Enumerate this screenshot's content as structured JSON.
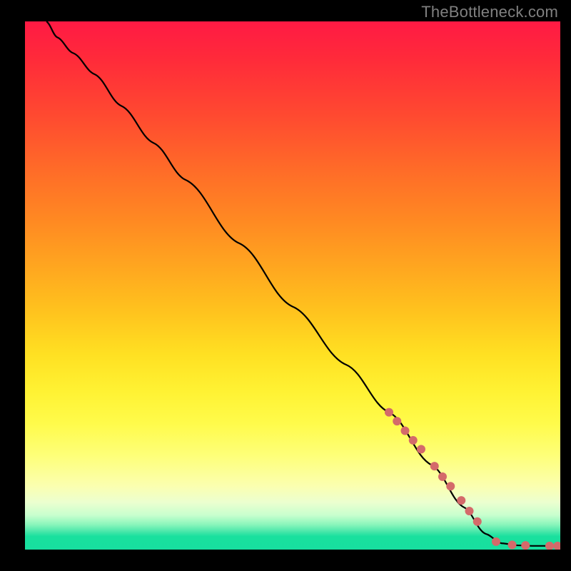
{
  "attribution": "TheBottleneck.com",
  "chart_data": {
    "type": "line",
    "title": "",
    "xlabel": "",
    "ylabel": "",
    "xlim": [
      0,
      100
    ],
    "ylim": [
      0,
      100
    ],
    "curve": [
      {
        "x": 4,
        "y": 100
      },
      {
        "x": 6,
        "y": 97
      },
      {
        "x": 9,
        "y": 94
      },
      {
        "x": 13,
        "y": 90
      },
      {
        "x": 18,
        "y": 84
      },
      {
        "x": 24,
        "y": 77
      },
      {
        "x": 30,
        "y": 70
      },
      {
        "x": 40,
        "y": 58
      },
      {
        "x": 50,
        "y": 46
      },
      {
        "x": 60,
        "y": 35
      },
      {
        "x": 68,
        "y": 26
      },
      {
        "x": 76,
        "y": 16
      },
      {
        "x": 82,
        "y": 8
      },
      {
        "x": 86,
        "y": 3
      },
      {
        "x": 89,
        "y": 1.2
      },
      {
        "x": 92,
        "y": 0.8
      },
      {
        "x": 95,
        "y": 0.7
      },
      {
        "x": 98,
        "y": 0.7
      },
      {
        "x": 100,
        "y": 0.7
      }
    ],
    "dots": [
      {
        "x": 68,
        "y": 26,
        "r": 6
      },
      {
        "x": 69.5,
        "y": 24.3,
        "r": 6
      },
      {
        "x": 71,
        "y": 22.5,
        "r": 6
      },
      {
        "x": 72.5,
        "y": 20.7,
        "r": 6
      },
      {
        "x": 74,
        "y": 19,
        "r": 6
      },
      {
        "x": 76.5,
        "y": 15.8,
        "r": 6
      },
      {
        "x": 78,
        "y": 13.8,
        "r": 6
      },
      {
        "x": 79.5,
        "y": 12,
        "r": 6
      },
      {
        "x": 81.5,
        "y": 9.3,
        "r": 6
      },
      {
        "x": 83,
        "y": 7.3,
        "r": 6
      },
      {
        "x": 84.5,
        "y": 5.3,
        "r": 6
      },
      {
        "x": 88,
        "y": 1.5,
        "r": 6
      },
      {
        "x": 91,
        "y": 0.9,
        "r": 6
      },
      {
        "x": 93.5,
        "y": 0.8,
        "r": 6
      },
      {
        "x": 98,
        "y": 0.7,
        "r": 6
      },
      {
        "x": 99.5,
        "y": 0.7,
        "r": 6
      }
    ],
    "dot_color": "#d46a6a",
    "curve_color": "#000000"
  }
}
